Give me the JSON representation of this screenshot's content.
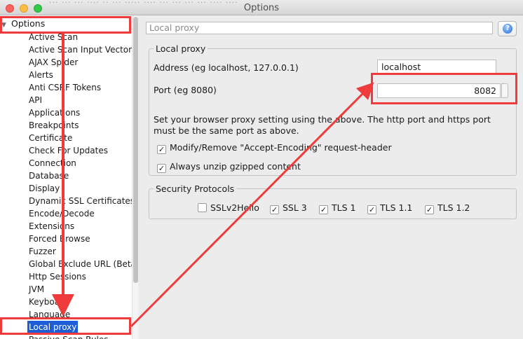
{
  "window": {
    "title": "Options",
    "ghost_text": "... ... ... .... .. ... ..... .... ... ... ... ... .... ...."
  },
  "tree": {
    "root": "Options",
    "items": [
      "Active Scan",
      "Active Scan Input Vectors",
      "AJAX Spider",
      "Alerts",
      "Anti CSRF Tokens",
      "API",
      "Applications",
      "Breakpoints",
      "Certificate",
      "Check For Updates",
      "Connection",
      "Database",
      "Display",
      "Dynamic SSL Certificates",
      "Encode/Decode",
      "Extensions",
      "Forced Browse",
      "Fuzzer",
      "Global Exclude URL (Beta",
      "Http Sessions",
      "JVM",
      "Keyboard",
      "Language",
      "Local proxy",
      "Passive Scan Rules"
    ],
    "selected": "Local proxy"
  },
  "panel": {
    "breadcrumb": "Local proxy",
    "help_icon": "help-icon",
    "local_proxy_group": "Local proxy",
    "address_label": "Address (eg localhost, 127.0.0.1)",
    "address_value": "localhost",
    "port_label": "Port (eg 8080)",
    "port_value": "8082",
    "description": "Set your browser proxy setting using the above. The http port and https port must be the same port as above.",
    "checkboxes": [
      {
        "label": "Modify/Remove \"Accept-Encoding\" request-header",
        "checked": true
      },
      {
        "label": "Always unzip gzipped content",
        "checked": true
      }
    ],
    "security_group": "Security Protocols",
    "protocols": [
      {
        "label": "SSLv2Hello",
        "checked": false
      },
      {
        "label": "SSL 3",
        "checked": true
      },
      {
        "label": "TLS 1",
        "checked": true
      },
      {
        "label": "TLS 1.1",
        "checked": true
      },
      {
        "label": "TLS 1.2",
        "checked": true
      }
    ]
  },
  "colors": {
    "annotation": "#ef3b3b",
    "selection": "#1d5ed8"
  }
}
